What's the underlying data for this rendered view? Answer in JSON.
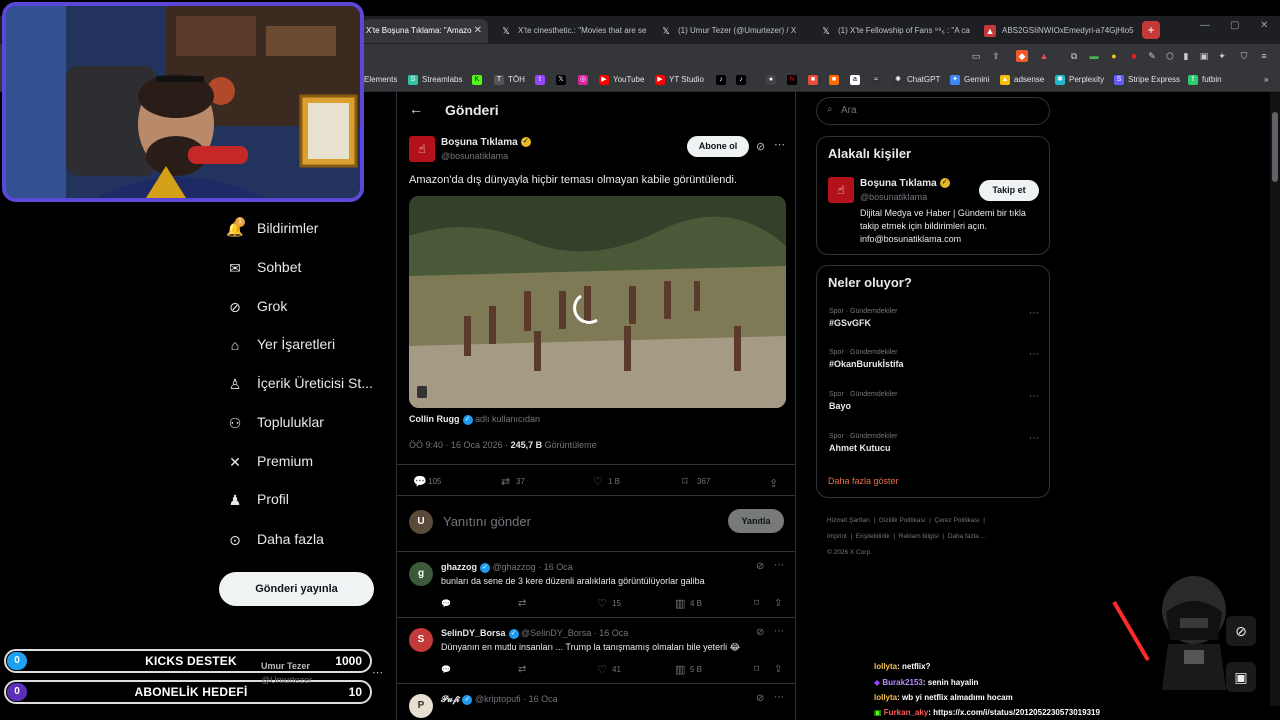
{
  "browser": {
    "tabs": [
      {
        "label": "X'te Boşuna Tıklama: \"Amazo",
        "active": true
      },
      {
        "label": "X'te cinesthetic.: \"Movies that are se",
        "active": false
      },
      {
        "label": "(1) Umur Tezer (@Umurtezer) / X",
        "active": false
      },
      {
        "label": "(1) X'te Fellowship of Fans ⁹⁹₆ : \"A ca",
        "active": false
      },
      {
        "label": "ABS2GSIiNWIOxEmedyri-a74GjHlo5",
        "active": false
      }
    ],
    "bookmarks": [
      "Elements",
      "Streamlabs",
      "TÖH",
      "YouTube",
      "YT Studio",
      "ChatGPT",
      "Gemini",
      "adsense",
      "Perplexity",
      "Stripe Express",
      "futbin"
    ]
  },
  "nav": {
    "items": [
      {
        "label": "Bildirimler",
        "icon": "bell-icon",
        "glyph": "🔔",
        "badge": "1"
      },
      {
        "label": "Sohbet",
        "icon": "mail-icon",
        "glyph": "✉"
      },
      {
        "label": "Grok",
        "icon": "grok-icon",
        "glyph": "⊘"
      },
      {
        "label": "Yer İşaretleri",
        "icon": "bookmark-icon",
        "glyph": "🔖"
      },
      {
        "label": "İçerik Üreticisi St...",
        "icon": "creator-studio-icon",
        "glyph": "♙"
      },
      {
        "label": "Topluluklar",
        "icon": "communities-icon",
        "glyph": "👥"
      },
      {
        "label": "Premium",
        "icon": "x-logo-icon",
        "glyph": "✕"
      },
      {
        "label": "Profil",
        "icon": "person-icon",
        "glyph": "👤"
      },
      {
        "label": "Daha fazla",
        "icon": "more-circle-icon",
        "glyph": "⋯"
      }
    ],
    "post_button": "Gönderi yayınla"
  },
  "post": {
    "header_title": "Gönderi",
    "author": "Boşuna Tıklama",
    "handle": "@bosunatiklama",
    "subscribe": "Abone ol",
    "text": "Amazon'da dış dünyayla hiçbir teması olmayan kabile görüntülendi.",
    "credit_name": "Collin Rugg",
    "credit_suffix": "adlı kullanıcıdan",
    "time": "ÖÖ 9:40 · 16 Oca 2026 ·",
    "views": "245,7 B",
    "views_label": "Görüntüleme",
    "replies": "105",
    "reposts": "37",
    "likes": "1 B",
    "bookmarks": "367",
    "reply_placeholder": "Yanıtını gönder",
    "reply_button": "Yanıtla"
  },
  "replies": [
    {
      "name": "ghazzog",
      "handle": "@ghazzog",
      "date": "· 16 Oca",
      "text": "bunları da sene de 3 kere düzenli aralıklarla görüntülüyorlar galiba",
      "replies": "",
      "reposts": "",
      "likes": "15",
      "views": "4 B"
    },
    {
      "name": "SelinDY_Borsa",
      "handle": "@SelinDY_Borsa",
      "date": "· 16 Oca",
      "text": "Dünyanın en mutlu insanları ... Trump la tanışmamış olmaları bile yeterli 😂",
      "replies": "",
      "reposts": "",
      "likes": "41",
      "views": "5 B"
    },
    {
      "name": "𝒫𝓊𝒻𝒾",
      "handle": "@kriptopufi",
      "date": "· 16 Oca",
      "text": "",
      "replies": "",
      "reposts": "",
      "likes": "",
      "views": ""
    }
  ],
  "sidebar": {
    "search_placeholder": "Ara",
    "related_title": "Alakalı kişiler",
    "related_name": "Boşuna Tıklama",
    "related_handle": "@bosunatiklama",
    "follow": "Takip et",
    "related_bio": "Dijital Medya ve Haber | Gündemi bir tıkla takip etmek için bildirimleri açın. info@bosunatiklama.com",
    "trends_title": "Neler oluyor?",
    "trends": [
      {
        "category": "Spor · Gündemdekiler",
        "name": "#GSvGFK"
      },
      {
        "category": "Spor · Gündemdekiler",
        "name": "#OkanBurukİstifa"
      },
      {
        "category": "Spor · Gündemdekiler",
        "name": "Bayo"
      },
      {
        "category": "Spor · Gündemdekiler",
        "name": "Ahmet Kutucu"
      }
    ],
    "show_more": "Daha fazla göster",
    "footer": [
      "Hizmet Şartları",
      "Gizlilik Politikası",
      "Çerez Politikası",
      "Imprint",
      "Erişilebilirlik",
      "Reklam bilgisi",
      "Daha fazla ...",
      "© 2026 X Corp."
    ]
  },
  "overlay": {
    "goal1_label": "KICKS DESTEK",
    "goal1_current": "0",
    "goal1_target": "1000",
    "goal2_label": "ABONELİK HEDEFİ",
    "goal2_current": "0",
    "goal2_target": "10",
    "account_name": "Umur Tezer",
    "account_handle": "@Umurtezer",
    "chat": [
      {
        "user": "lollyta",
        "msg": ": netflix?"
      },
      {
        "user": "Burak2153",
        "msg": ": senin hayalin"
      },
      {
        "user": "lollyta",
        "msg": ": wb yi netflix almadımı hocam"
      },
      {
        "user": "Furkan_aky",
        "msg": ": https://x.com/i/status/2012052230573019319"
      }
    ],
    "accent_color": "#5b47d8"
  }
}
